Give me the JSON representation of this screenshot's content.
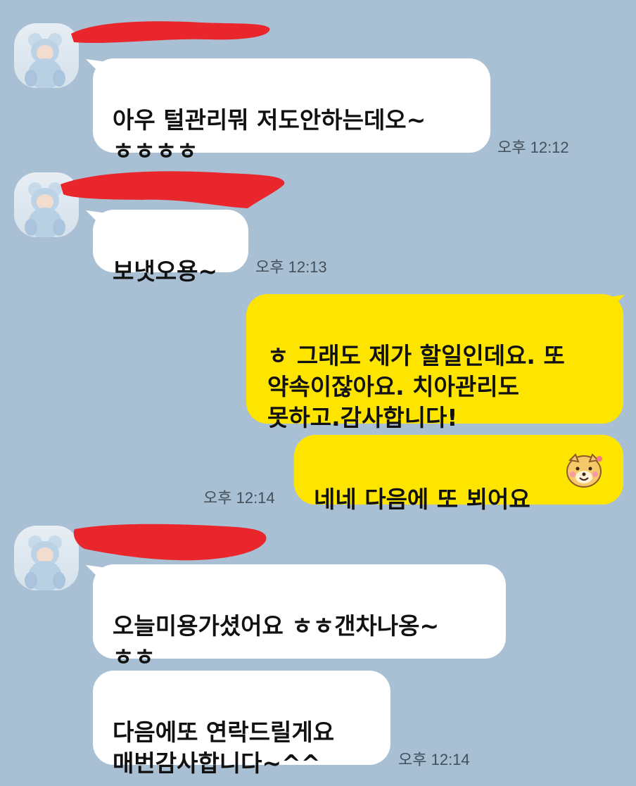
{
  "colors": {
    "background": "#a9bfd3",
    "incoming_bubble": "#ffffff",
    "outgoing_bubble": "#fee500",
    "redaction": "#e8262b"
  },
  "messages": [
    {
      "side": "incoming",
      "sender_redacted": true,
      "avatar": "baby-avatar",
      "text": "아우 털관리뭐 저도안하는데오~\nㅎㅎㅎㅎ",
      "time": "오후 12:12"
    },
    {
      "side": "incoming",
      "sender_redacted": true,
      "avatar": "baby-avatar",
      "text": "보냇오용~",
      "time": "오후 12:13"
    },
    {
      "side": "outgoing",
      "text": "ㅎ 그래도 제가 할일인데요. 또\n약속이잖아요. 치아관리도\n못하고.감사합니다!"
    },
    {
      "side": "outgoing",
      "text": "네네  다음에 또 뵈어요",
      "emoji": "cute-dog-emoji",
      "time": "오후 12:14"
    },
    {
      "side": "incoming",
      "sender_redacted": true,
      "avatar": "baby-avatar",
      "text": "오늘미용가셨어요 ㅎㅎ갠차나옹~\nㅎㅎ"
    },
    {
      "side": "incoming",
      "text": "다음에또 연락드릴게요\n매번감사합니다~^^",
      "time": "오후 12:14"
    }
  ]
}
